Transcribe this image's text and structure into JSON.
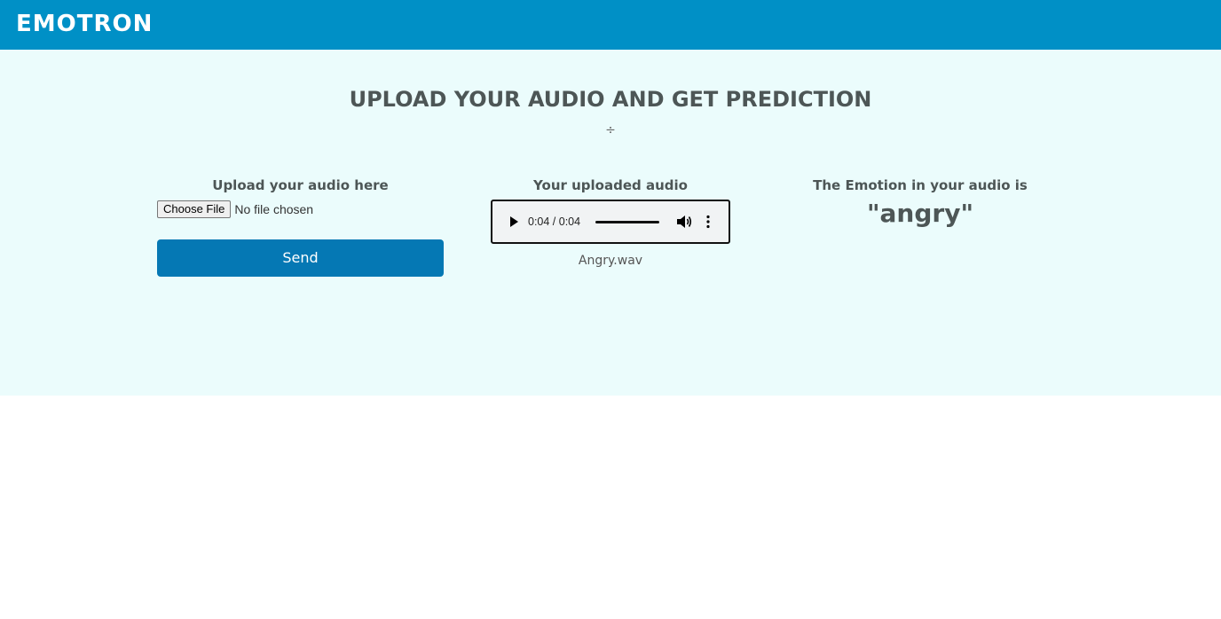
{
  "header": {
    "brand": "EMOTRON",
    "color": "#0090c6"
  },
  "page": {
    "title": "UPLOAD YOUR AUDIO AND GET PREDICTION",
    "divider_glyph": "÷",
    "background": "#ebfcfc"
  },
  "upload": {
    "heading": "Upload your audio here",
    "choose_label": "Choose File",
    "file_status": "No file chosen",
    "send_label": "Send",
    "send_color": "#0578b4"
  },
  "player": {
    "heading": "Your uploaded audio",
    "time": "0:04 / 0:04",
    "progress": 1.0,
    "file_name": "Angry.wav",
    "icons": [
      "play-icon",
      "volume-icon",
      "more-vert-icon"
    ]
  },
  "result": {
    "heading": "The Emotion in your audio is",
    "emotion": "\"angry\""
  }
}
